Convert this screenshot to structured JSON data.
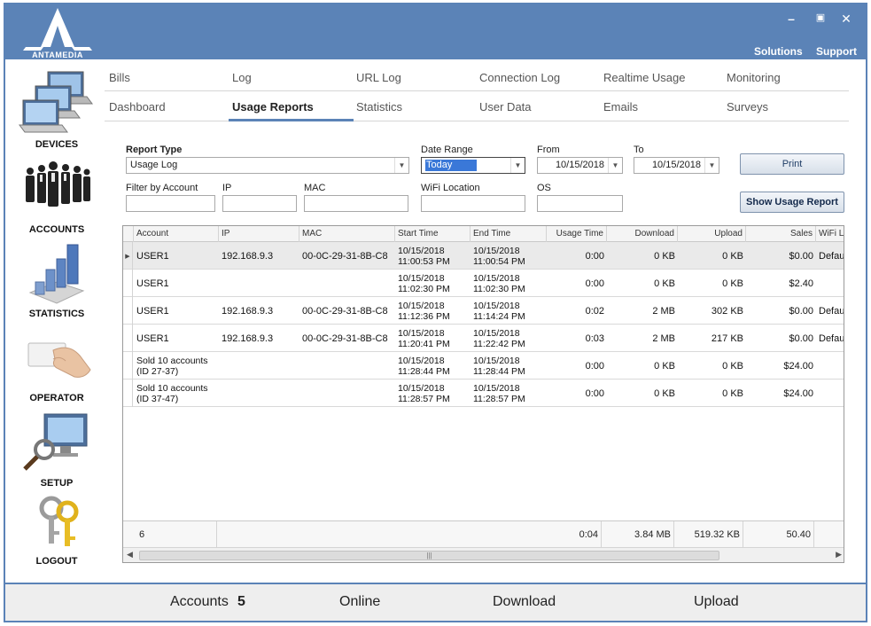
{
  "app": {
    "logo_text": "ANTAMEDIA"
  },
  "window_controls": {
    "minimize": "–",
    "restore": "▣",
    "close": "✕"
  },
  "top_links": {
    "solutions": "Solutions",
    "support": "Support"
  },
  "sidebar": {
    "items": [
      {
        "label": "DEVICES",
        "icon": "devices-icon"
      },
      {
        "label": "ACCOUNTS",
        "icon": "accounts-icon"
      },
      {
        "label": "STATISTICS",
        "icon": "statistics-icon"
      },
      {
        "label": "OPERATOR",
        "icon": "operator-icon"
      },
      {
        "label": "SETUP",
        "icon": "setup-icon"
      },
      {
        "label": "LOGOUT",
        "icon": "logout-icon"
      }
    ]
  },
  "tabs": {
    "row1": [
      "Bills",
      "Log",
      "URL Log",
      "Connection Log",
      "Realtime Usage",
      "Monitoring"
    ],
    "row2": [
      "Dashboard",
      "Usage Reports",
      "Statistics",
      "User Data",
      "Emails",
      "Surveys"
    ],
    "active": "Usage Reports"
  },
  "filters": {
    "report_type_label": "Report Type",
    "report_type_value": "Usage Log",
    "date_range_label": "Date Range",
    "date_range_value": "Today",
    "from_label": "From",
    "from_value": "10/15/2018",
    "to_label": "To",
    "to_value": "10/15/2018",
    "print_label": "Print",
    "filter_account_label": "Filter by Account",
    "ip_label": "IP",
    "mac_label": "MAC",
    "wifi_label": "WiFi Location",
    "os_label": "OS",
    "show_report_label": "Show Usage Report"
  },
  "table": {
    "columns": [
      "Account",
      "IP",
      "MAC",
      "Start Time",
      "End Time",
      "Usage Time",
      "Download",
      "Upload",
      "Sales",
      "WiFi L"
    ],
    "rows": [
      {
        "account": "USER1",
        "ip": "192.168.9.3",
        "mac": "00-0C-29-31-8B-C8",
        "start": "10/15/2018\n11:00:53 PM",
        "end": "10/15/2018\n11:00:54 PM",
        "usage": "0:00",
        "download": "0 KB",
        "upload": "0 KB",
        "sales": "$0.00",
        "wifi": "Defau"
      },
      {
        "account": "USER1",
        "ip": "",
        "mac": "",
        "start": "10/15/2018\n11:02:30 PM",
        "end": "10/15/2018\n11:02:30 PM",
        "usage": "0:00",
        "download": "0 KB",
        "upload": "0 KB",
        "sales": "$2.40",
        "wifi": ""
      },
      {
        "account": "USER1",
        "ip": "192.168.9.3",
        "mac": "00-0C-29-31-8B-C8",
        "start": "10/15/2018\n11:12:36 PM",
        "end": "10/15/2018\n11:14:24 PM",
        "usage": "0:02",
        "download": "2 MB",
        "upload": "302 KB",
        "sales": "$0.00",
        "wifi": "Defau"
      },
      {
        "account": "USER1",
        "ip": "192.168.9.3",
        "mac": "00-0C-29-31-8B-C8",
        "start": "10/15/2018\n11:20:41 PM",
        "end": "10/15/2018\n11:22:42 PM",
        "usage": "0:03",
        "download": "2 MB",
        "upload": "217 KB",
        "sales": "$0.00",
        "wifi": "Defau"
      },
      {
        "account": "Sold 10 accounts\n(ID 27-37)",
        "ip": "",
        "mac": "",
        "start": "10/15/2018\n11:28:44 PM",
        "end": "10/15/2018\n11:28:44 PM",
        "usage": "0:00",
        "download": "0 KB",
        "upload": "0 KB",
        "sales": "$24.00",
        "wifi": ""
      },
      {
        "account": "Sold 10 accounts\n(ID 37-47)",
        "ip": "",
        "mac": "",
        "start": "10/15/2018\n11:28:57 PM",
        "end": "10/15/2018\n11:28:57 PM",
        "usage": "0:00",
        "download": "0 KB",
        "upload": "0 KB",
        "sales": "$24.00",
        "wifi": ""
      }
    ],
    "footer": {
      "count": "6",
      "usage": "0:04",
      "download": "3.84 MB",
      "upload": "519.32 KB",
      "sales": "50.40"
    },
    "scroll_grip": "|||"
  },
  "statusbar": {
    "accounts_label": "Accounts",
    "accounts_value": "5",
    "online_label": "Online",
    "download_label": "Download",
    "upload_label": "Upload"
  },
  "colors": {
    "header": "#5b83b7",
    "accent": "#5b83b7"
  }
}
